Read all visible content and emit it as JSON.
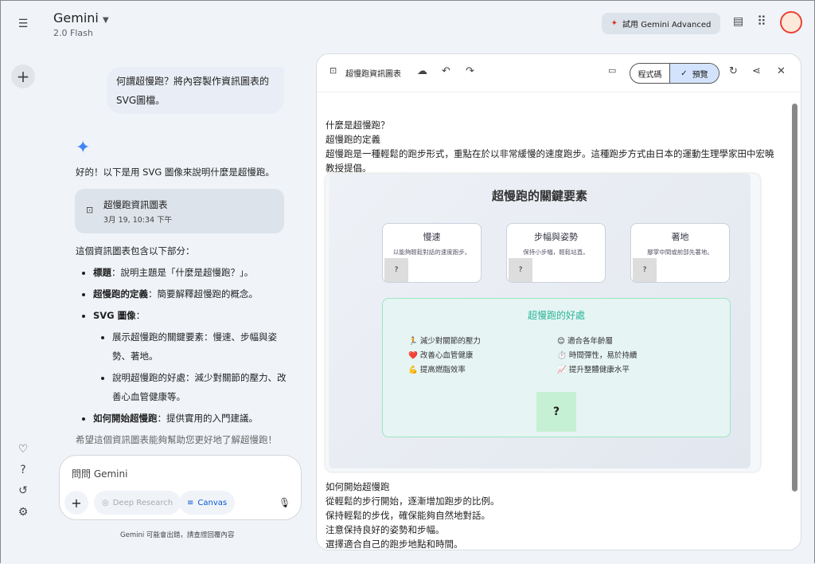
{
  "app": {
    "title": "Gemini",
    "model": "2.0 Flash",
    "advanced_button": "試用 Gemini Advanced"
  },
  "chat": {
    "user_message": "何謂超慢跑？將內容製作資訊圖表的SVG圖檔。",
    "intro": "好的！以下是用 SVG 圖像來說明什麼是超慢跑。",
    "artifact": {
      "title": "超慢跑資訊圖表",
      "date": "3月 19, 10:34 下午"
    },
    "summary": "這個資訊圖表包含以下部分：",
    "items": [
      {
        "bold": "標題",
        "text": "：說明主題是「什麼是超慢跑？」。"
      },
      {
        "bold": "超慢跑的定義",
        "text": "：簡要解釋超慢跑的概念。"
      },
      {
        "bold": "SVG 圖像",
        "text": "："
      },
      {
        "bold": "如何開始超慢跑",
        "text": "：提供實用的入門建議。"
      }
    ],
    "subitems": [
      "展示超慢跑的關鍵要素：慢速、步幅與姿勢、著地。",
      "說明超慢跑的好處：減少對關節的壓力、改善心血管健康等。"
    ],
    "closing": "希望這個資訊圖表能夠幫助您更好地了解超慢跑！"
  },
  "input": {
    "placeholder": "問問 Gemini",
    "deep_research": "Deep Research",
    "canvas": "Canvas",
    "disclaimer": "Gemini 可能會出錯，請查證回覆內容"
  },
  "panel": {
    "title": "超慢跑資訊圖表",
    "code_tab": "程式碼",
    "preview_tab": "預覽"
  },
  "doc": {
    "lines": [
      "什麼是超慢跑？",
      "超慢跑的定義",
      "超慢跑是一種輕鬆的跑步形式，重點在於以非常緩慢的速度跑步。這種跑步方式由日本的運動生理學家田中宏曉教授提倡。"
    ],
    "infographic": {
      "title": "超慢跑的關鍵要素",
      "cards": [
        {
          "h": "慢速",
          "d": "以能夠輕鬆對話的速度跑步。"
        },
        {
          "h": "步幅與姿勢",
          "d": "保持小步幅，輕鬆站直。"
        },
        {
          "h": "著地",
          "d": "腳掌中間或前部先著地。"
        }
      ],
      "benefits_title": "超慢跑的好處",
      "benefits": [
        {
          "i": "🏃",
          "t": "減少對關節的壓力"
        },
        {
          "i": "❤️",
          "t": "改善心血管健康"
        },
        {
          "i": "💪",
          "t": "提高燃脂效率"
        },
        {
          "i": "😊",
          "t": "適合各年齡層"
        },
        {
          "i": "⏱️",
          "t": "時間彈性，易於持續"
        },
        {
          "i": "📈",
          "t": "提升整體健康水平"
        }
      ],
      "placeholder": "?"
    },
    "start_lines": [
      "如何開始超慢跑",
      "從輕鬆的步行開始，逐漸增加跑步的比例。",
      "保持輕鬆的步伐，確保能夠自然地對話。",
      "注意保持良好的姿勢和步幅。",
      "選擇適合自己的跑步地點和時間。"
    ]
  }
}
